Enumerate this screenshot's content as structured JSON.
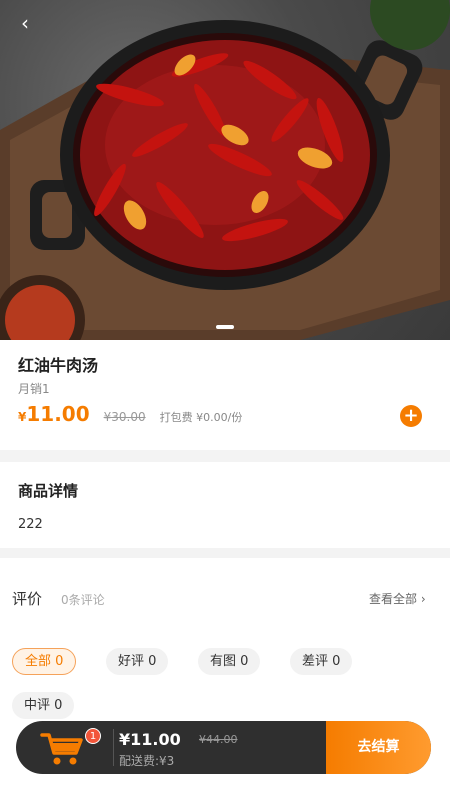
{
  "nav": {
    "back_label": "‹"
  },
  "product": {
    "name": "红油牛肉汤",
    "sales": "月销1",
    "currency": "¥",
    "price": "11.00",
    "original_price": "¥30.00",
    "packing_fee": "打包费 ¥0.00/份",
    "add_label": "+"
  },
  "detail": {
    "title": "商品详情",
    "content": "222"
  },
  "reviews": {
    "title": "评价",
    "count": "0条评论",
    "see_all": "查看全部 ›",
    "filters": [
      "全部 0",
      "好评 0",
      "有图 0",
      "差评 0",
      "中评 0"
    ]
  },
  "cart": {
    "badge": "1",
    "total": "¥11.00",
    "original_total": "¥44.00",
    "delivery": "配送费:¥3",
    "checkout_label": "去结算"
  },
  "icons": {
    "back": "chevron-left-icon",
    "add": "plus-circle-icon",
    "cart": "shopping-cart-icon"
  },
  "colors": {
    "accent": "#f57c00",
    "cart_bar": "#2f2f2f",
    "badge": "#f2563a"
  }
}
